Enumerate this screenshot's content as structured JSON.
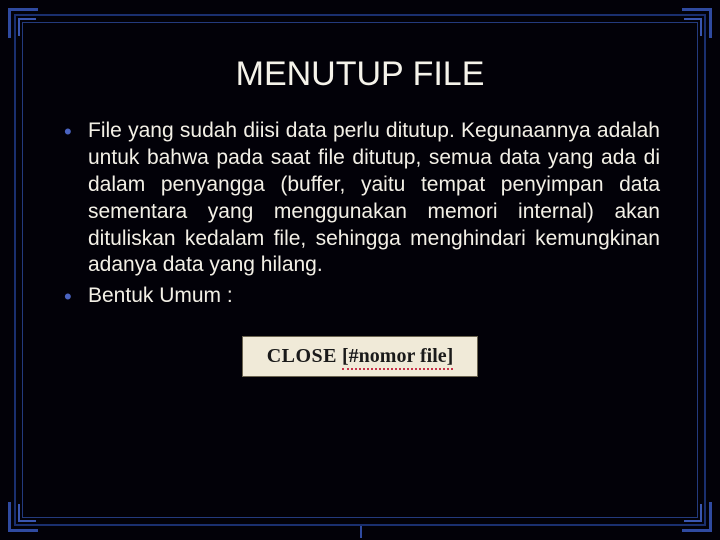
{
  "slide": {
    "title": "MENUTUP FILE",
    "bullets": [
      "File yang sudah diisi data perlu ditutup. Kegunaannya adalah untuk bahwa pada saat file ditutup, semua data yang ada di dalam penyangga (buffer, yaitu tempat penyimpan data sementara yang menggunakan memori internal) akan dituliskan kedalam file, sehingga menghindari kemungkinan adanya data yang hilang.",
      "Bentuk Umum :"
    ],
    "syntax": {
      "keyword": "CLOSE",
      "arg": "[#nomor file]"
    }
  },
  "colors": {
    "background": "#020108",
    "border": "#1a2f6e",
    "bullet": "#4a63c0",
    "text": "#f3f0e6",
    "box_bg": "#f0ead8"
  }
}
